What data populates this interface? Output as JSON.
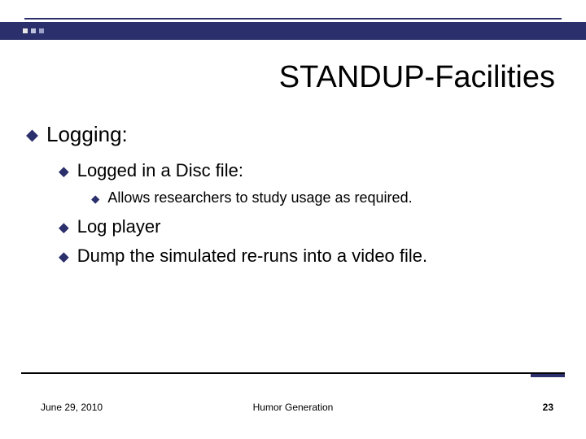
{
  "title": "STANDUP-Facilities",
  "bullets": {
    "lvl1": "Logging:",
    "lvl2_a": "Logged in a Disc file:",
    "lvl3_a": "Allows researchers to study usage as required.",
    "lvl2_b": "Log player",
    "lvl2_c": "Dump the simulated re-runs into a video file."
  },
  "footer": {
    "date": "June 29, 2010",
    "center": "Humor Generation",
    "page": "23"
  }
}
